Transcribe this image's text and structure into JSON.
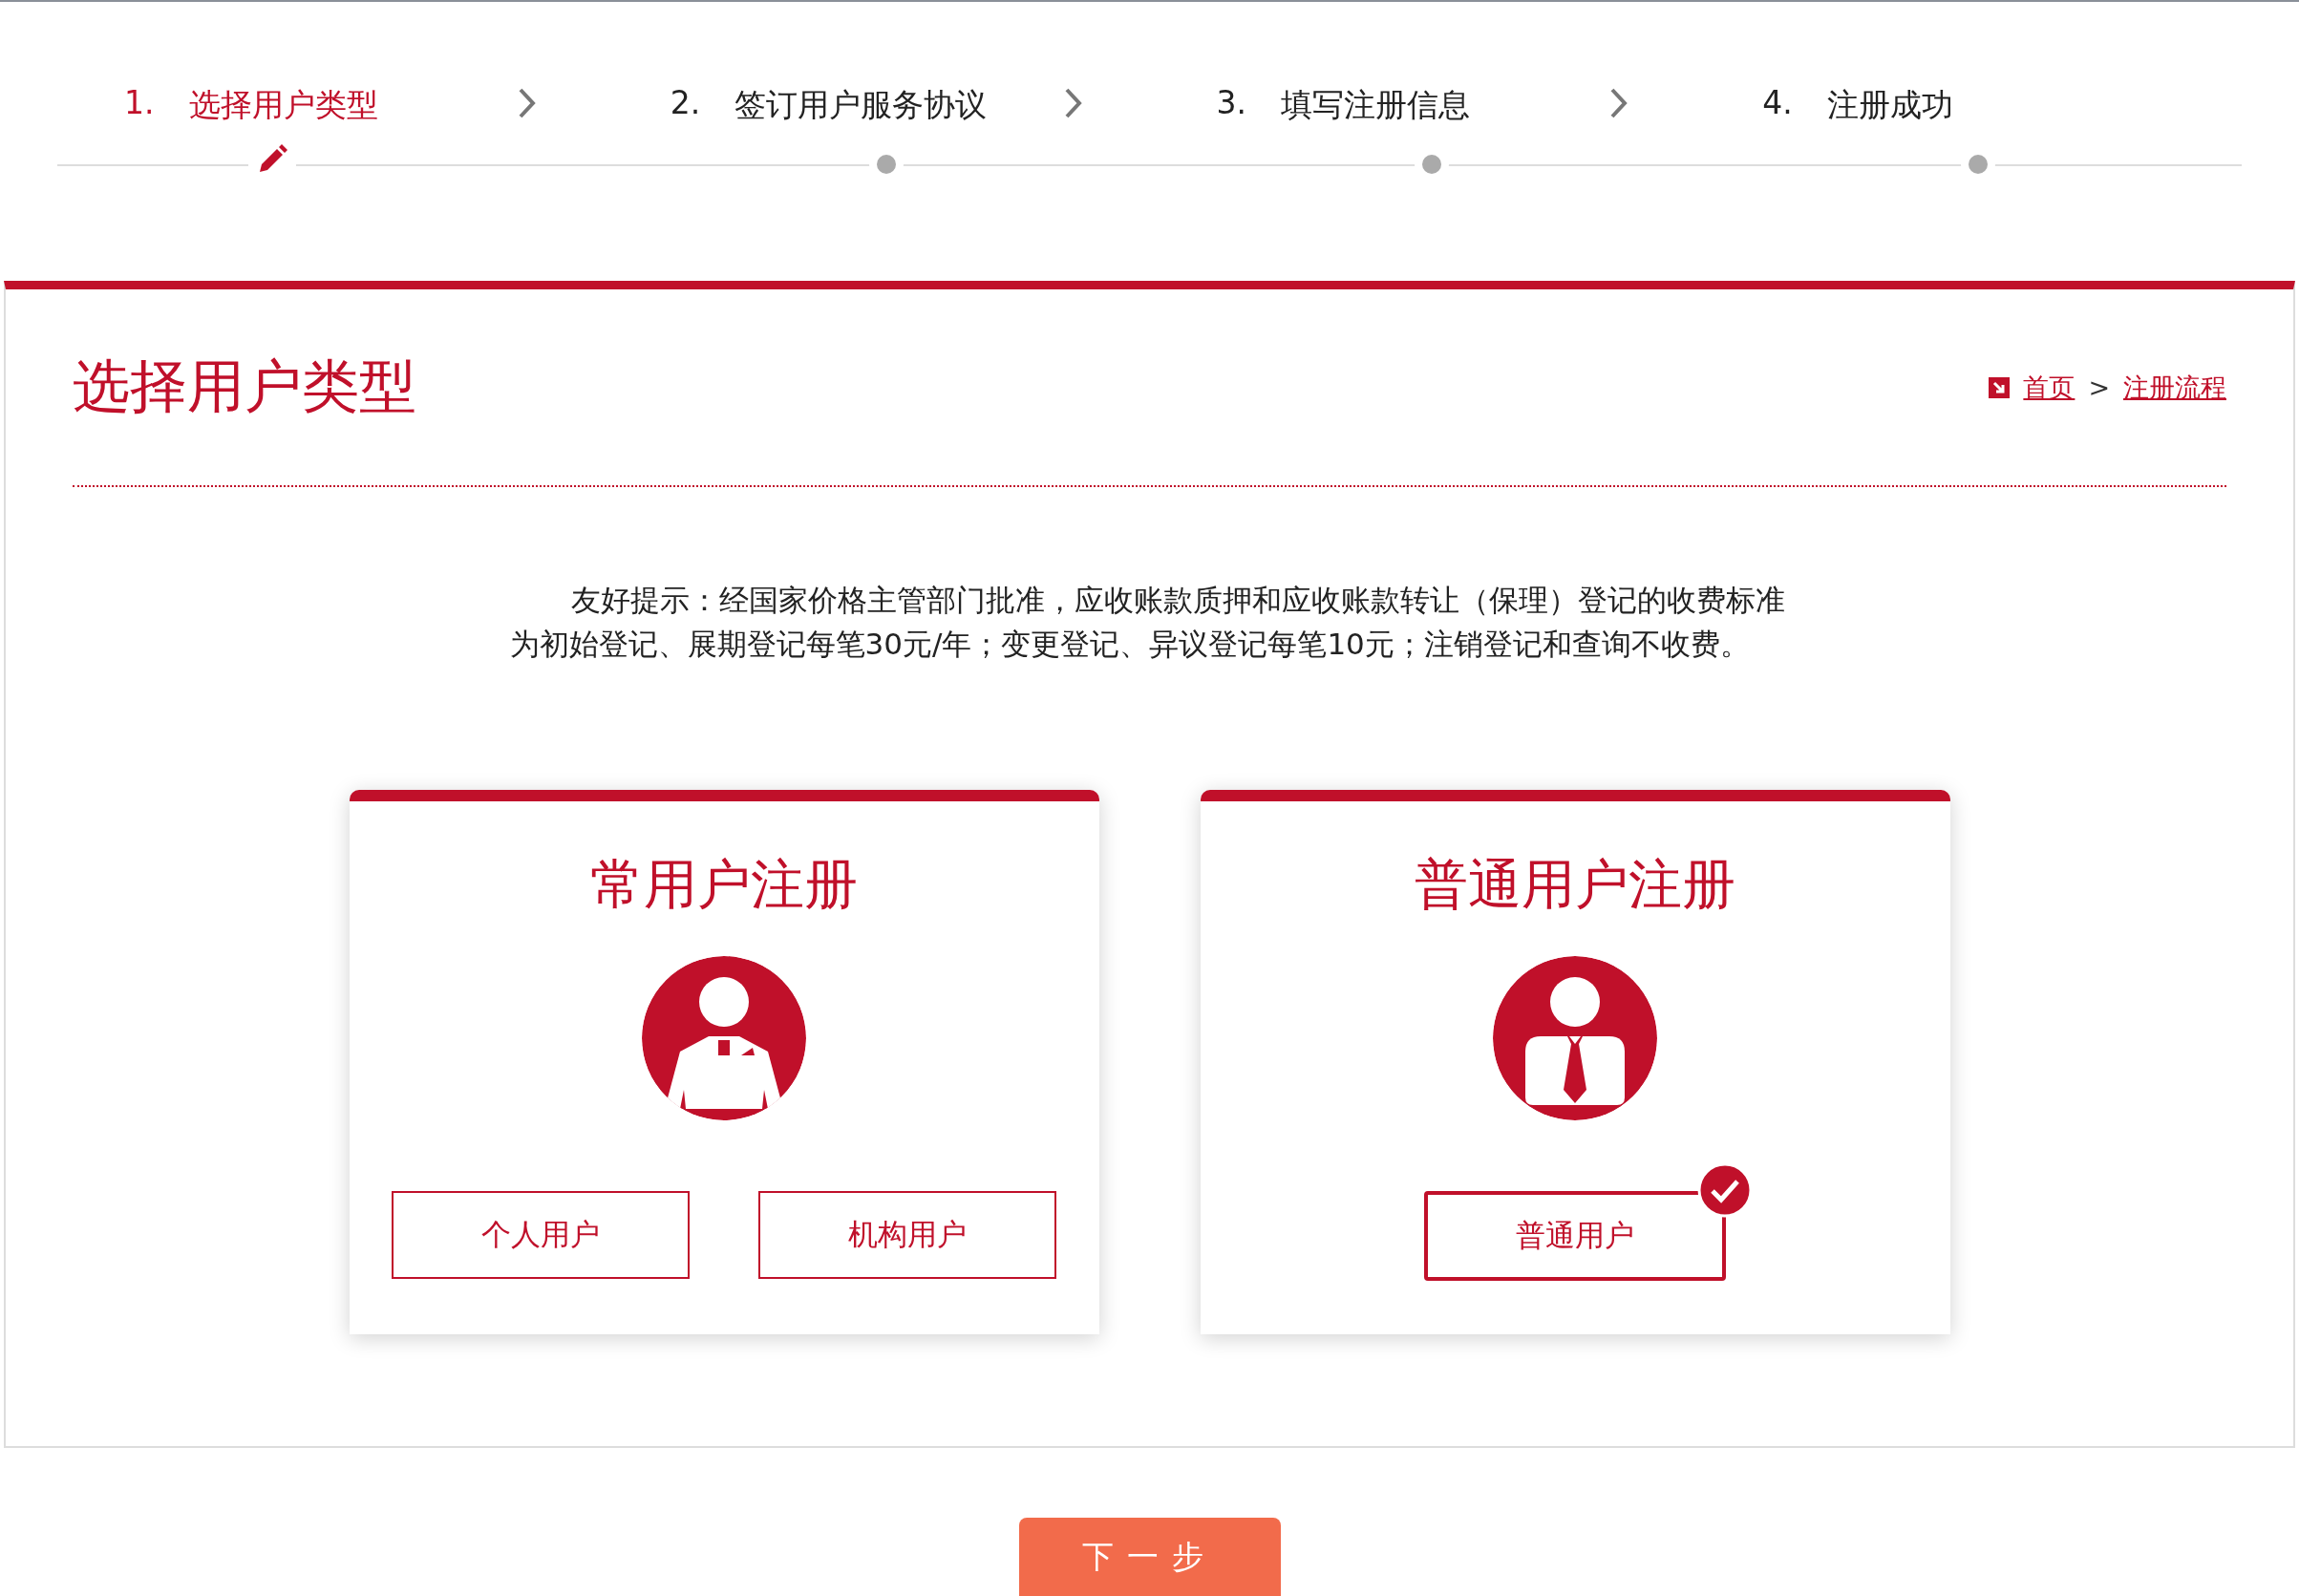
{
  "steps": [
    {
      "number": "1.",
      "label": "选择用户类型",
      "selected": true
    },
    {
      "number": "2.",
      "label": "签订用户服务协议",
      "selected": false
    },
    {
      "number": "3.",
      "label": "填写注册信息",
      "selected": false
    },
    {
      "number": "4.",
      "label": "注册成功",
      "selected": false
    }
  ],
  "page_title": "选择用户类型",
  "breadcrumb": [
    "首页",
    "注册流程"
  ],
  "breadcrumb_separator": ">",
  "notice": "友好提示：经国家价格主管部门批准，应收账款质押和应收账款转让（保理）登记的收费标准为初始登记、展期登记每笔30元/年；变更登记、异议登记每笔10元；注销登记和查询不收费。",
  "cards": [
    {
      "title": "常用户注册",
      "kind": "staff",
      "options": [
        {
          "label": "个人用户",
          "selected": false
        },
        {
          "label": "机构用户",
          "selected": false
        }
      ]
    },
    {
      "title": "普通用户注册",
      "kind": "suit",
      "options": [
        {
          "label": "普通用户",
          "selected": true
        }
      ]
    }
  ],
  "next_button": "下一步"
}
